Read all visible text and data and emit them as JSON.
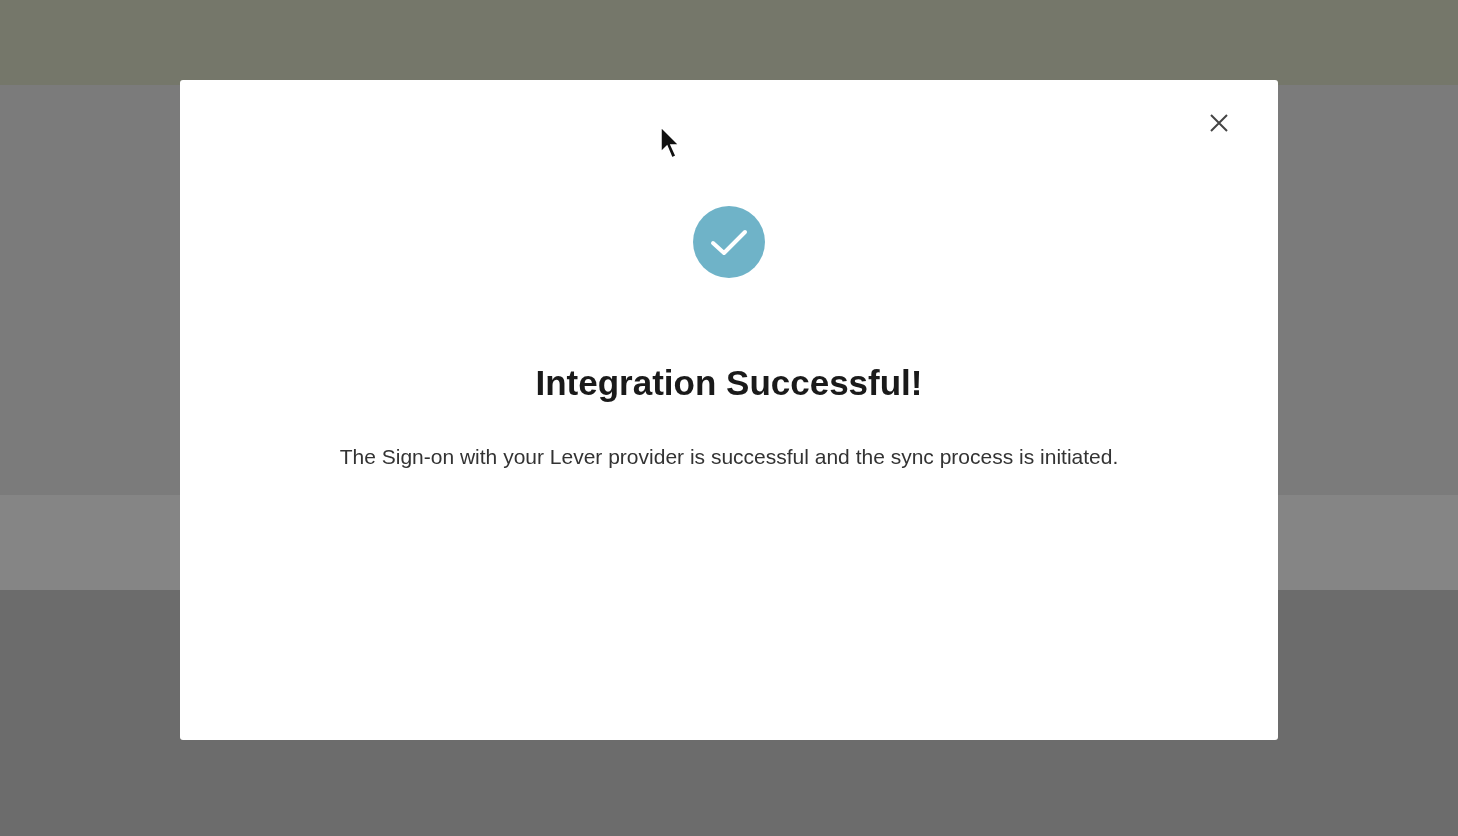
{
  "dialog": {
    "title": "Integration Successful!",
    "message": "The Sign-on with your Lever provider is successful and the sync process is initiated."
  }
}
